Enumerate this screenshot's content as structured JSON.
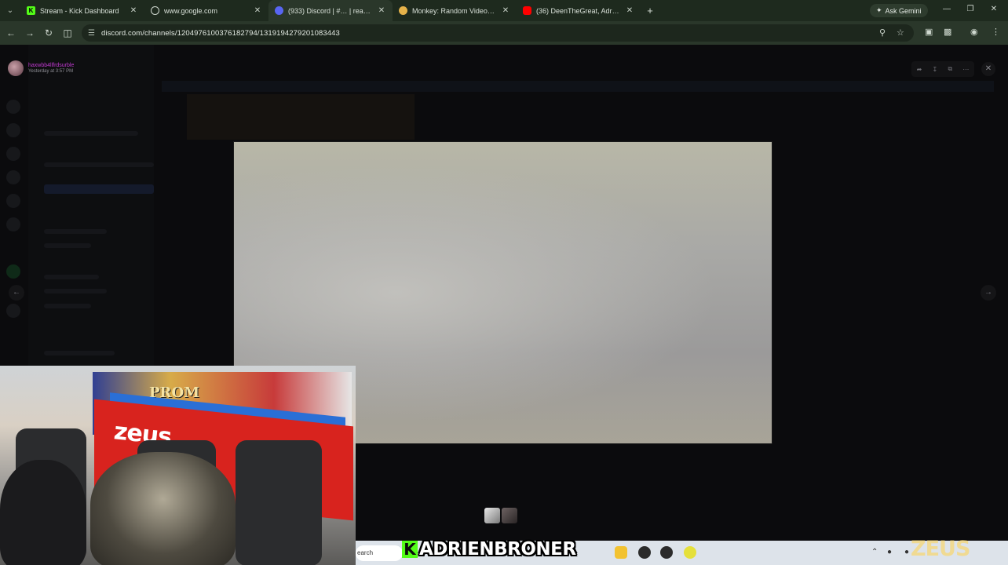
{
  "browser": {
    "tabs": [
      {
        "title": "Stream - Kick Dashboard",
        "icon": "kick-icon",
        "color": "#53fc18"
      },
      {
        "title": "www.google.com",
        "icon": "globe-icon",
        "color": "#cfd8cf"
      },
      {
        "title": "(933) Discord | #… | reactions",
        "icon": "discord-icon",
        "color": "#5865f2",
        "active": true
      },
      {
        "title": "Monkey: Random Video Chat |",
        "icon": "monkey-icon",
        "color": "#e5b24a"
      },
      {
        "title": "(36) DeenTheGreat, Adrien Bro…",
        "icon": "youtube-icon",
        "color": "#ff0000"
      }
    ],
    "gemini_label": "Ask Gemini",
    "url": "discord.com/channels/1204976100376182794/1319194279201083443"
  },
  "lightbox": {
    "username": "haxwbb4llfrdsurble",
    "timestamp": "Yesterday at 3:57 PM"
  },
  "taskbar": {
    "search_placeholder": "earch"
  },
  "overlay": {
    "platform_badge": "K",
    "streamer_name": "ADRIENBRONER",
    "sponsor_watermark": "ZEUS",
    "webcam_banner": "PROM",
    "webcam_brand": "zeus"
  },
  "colors": {
    "chrome_frame": "#1e2a1e",
    "kick_green": "#53fc18",
    "discord_username": "#c03ad0"
  }
}
